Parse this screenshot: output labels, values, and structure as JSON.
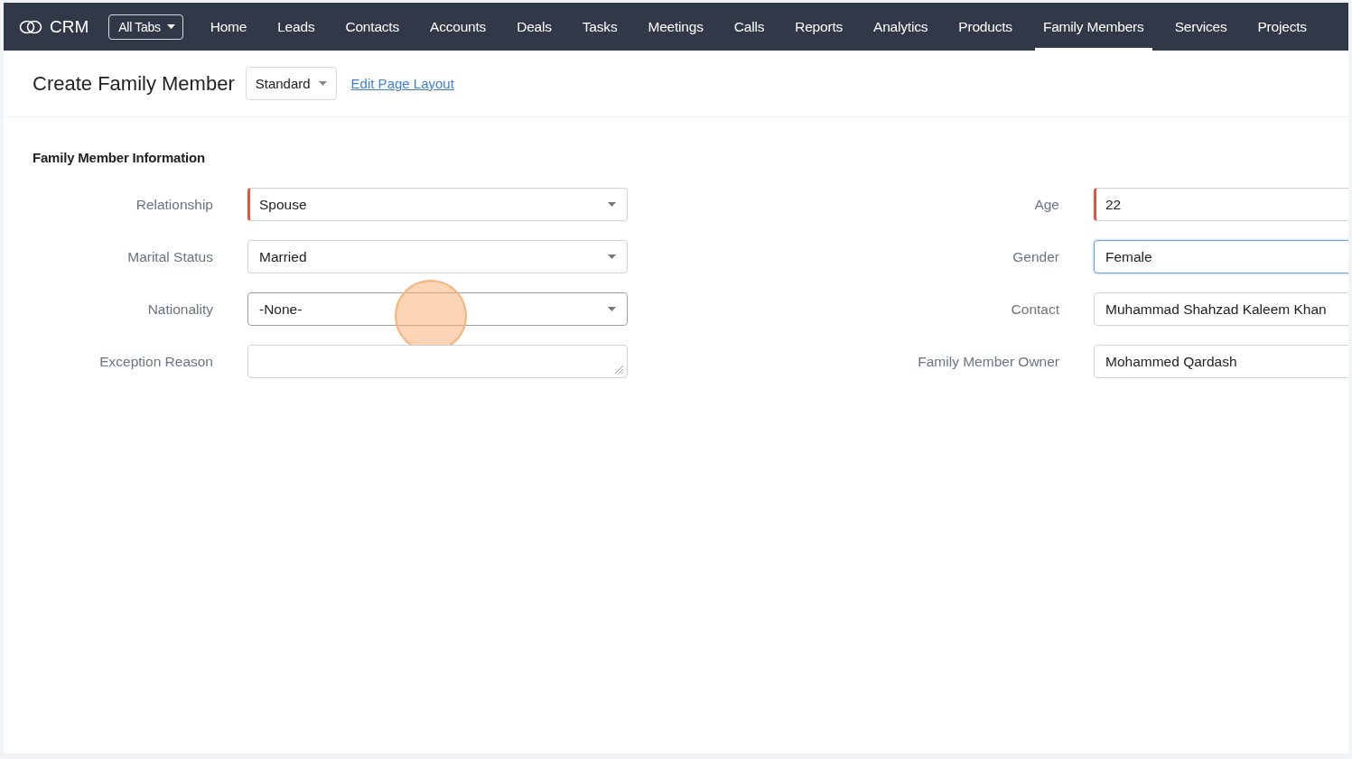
{
  "nav": {
    "logo": "CRM",
    "all_tabs": "All Tabs",
    "tabs": [
      {
        "label": "Home",
        "selected": false
      },
      {
        "label": "Leads",
        "selected": false
      },
      {
        "label": "Contacts",
        "selected": false
      },
      {
        "label": "Accounts",
        "selected": false
      },
      {
        "label": "Deals",
        "selected": false
      },
      {
        "label": "Tasks",
        "selected": false
      },
      {
        "label": "Meetings",
        "selected": false
      },
      {
        "label": "Calls",
        "selected": false
      },
      {
        "label": "Reports",
        "selected": false
      },
      {
        "label": "Analytics",
        "selected": false
      },
      {
        "label": "Products",
        "selected": false
      },
      {
        "label": "Family Members",
        "selected": true
      },
      {
        "label": "Services",
        "selected": false
      },
      {
        "label": "Projects",
        "selected": false
      }
    ]
  },
  "header": {
    "title": "Create Family Member",
    "layout": "Standard",
    "edit_link": "Edit Page Layout"
  },
  "section": {
    "title": "Family Member Information",
    "left_fields": [
      {
        "label": "Relationship",
        "kind": "select",
        "value": "Spouse",
        "required": true,
        "focused": false,
        "cursor": false
      },
      {
        "label": "Marital Status",
        "kind": "select",
        "value": "Married",
        "required": false,
        "focused": false,
        "cursor": false
      },
      {
        "label": "Nationality",
        "kind": "select",
        "value": "-None-",
        "required": false,
        "focused": false,
        "cursor": true
      },
      {
        "label": "Exception Reason",
        "kind": "textarea",
        "required": false,
        "focused": false,
        "cursor": false
      }
    ],
    "right_fields": [
      {
        "label": "Age",
        "kind": "text",
        "value": "22",
        "required": true,
        "focused": false,
        "cursor": false
      },
      {
        "label": "Gender",
        "kind": "text",
        "value": "Female",
        "required": false,
        "focused": true,
        "cursor": false
      },
      {
        "label": "Contact",
        "kind": "text",
        "value": "Muhammad Shahzad Kaleem Khan",
        "required": false,
        "focused": false,
        "cursor": false
      },
      {
        "label": "Family Member Owner",
        "kind": "text",
        "value": "Mohammed Qardash",
        "required": false,
        "focused": false,
        "cursor": false
      }
    ]
  }
}
